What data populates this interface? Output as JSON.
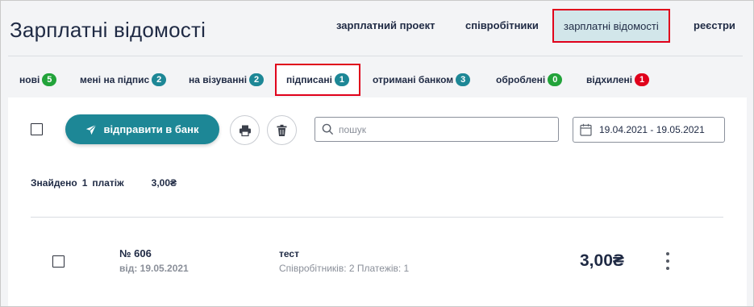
{
  "header": {
    "title": "Зарплатні відомості",
    "nav": [
      {
        "label": "зарплатний проект"
      },
      {
        "label": "співробітники"
      },
      {
        "label": "зарплатні відомості"
      },
      {
        "label": "реєстри"
      }
    ]
  },
  "tabs": [
    {
      "label": "нові",
      "count": "5",
      "color": "#22a33a"
    },
    {
      "label": "мені на підпис",
      "count": "2",
      "color": "#1d8796"
    },
    {
      "label": "на візуванні",
      "count": "2",
      "color": "#1d8796"
    },
    {
      "label": "підписані",
      "count": "1",
      "color": "#1d8796"
    },
    {
      "label": "отримані банком",
      "count": "3",
      "color": "#1d8796"
    },
    {
      "label": "оброблені",
      "count": "0",
      "color": "#22a33a"
    },
    {
      "label": "відхилені",
      "count": "1",
      "color": "#e0001b"
    }
  ],
  "toolbar": {
    "send_label": "відправити в банк",
    "search_placeholder": "пошук",
    "date_range": "19.04.2021 - 19.05.2021"
  },
  "summary": {
    "found_label": "Знайдено",
    "count": "1",
    "unit": "платіж",
    "total": "3,00₴"
  },
  "row": {
    "number": "№ 606",
    "date": "від: 19.05.2021",
    "name": "тест",
    "meta": "Співробітників: 2  Платежів: 1",
    "amount": "3,00₴"
  }
}
